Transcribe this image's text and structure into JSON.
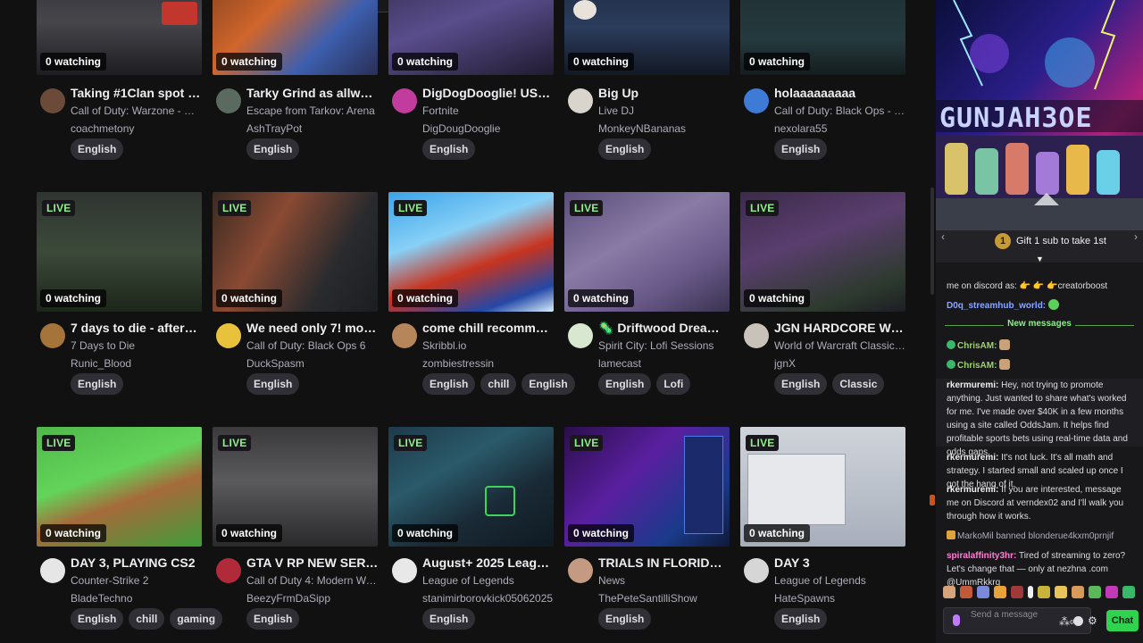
{
  "cards": [
    {
      "title": "Taking #1Clan spot in ...",
      "game": "Call of Duty: Warzone - Mob...",
      "streamer": "coachmetony",
      "viewers": "0 watching",
      "live": "",
      "tags": [
        "English"
      ]
    },
    {
      "title": "Tarky Grind as allways",
      "game": "Escape from Tarkov: Arena",
      "streamer": "AshTrayPot",
      "viewers": "0 watching",
      "live": "",
      "tags": [
        "English"
      ]
    },
    {
      "title": "DigDogDooglie! USE C...",
      "game": "Fortnite",
      "streamer": "DigDougDooglie",
      "viewers": "0 watching",
      "live": "",
      "tags": [
        "English"
      ]
    },
    {
      "title": "Big Up",
      "game": "Live DJ",
      "streamer": "MonkeyNBananas",
      "viewers": "0 watching",
      "live": "",
      "tags": [
        "English"
      ]
    },
    {
      "title": "holaaaaaaaaa",
      "game": "Call of Duty: Black Ops - De...",
      "streamer": "nexolara55",
      "viewers": "0 watching",
      "live": "",
      "tags": [
        "English"
      ]
    },
    {
      "title": "7 days to die - afterma...",
      "game": "7 Days to Die",
      "streamer": "Runic_Blood",
      "viewers": "0 watching",
      "live": "LIVE",
      "tags": [
        "English"
      ]
    },
    {
      "title": "We need only 7! more ...",
      "game": "Call of Duty: Black Ops 6",
      "streamer": "DuckSpasm",
      "viewers": "0 watching",
      "live": "LIVE",
      "tags": [
        "English"
      ]
    },
    {
      "title": "come chill recommend...",
      "game": "Skribbl.io",
      "streamer": "zombiestressin",
      "viewers": "0 watching",
      "live": "LIVE",
      "tags": [
        "English",
        "chill",
        "English"
      ]
    },
    {
      "title": "🦠 Driftwood Dreams 🌙",
      "game": "Spirit City: Lofi Sessions",
      "streamer": "lamecast",
      "viewers": "0 watching",
      "live": "LIVE",
      "tags": [
        "English",
        "Lofi"
      ]
    },
    {
      "title": "JGN HARDCORE WOW...",
      "game": "World of Warcraft Classic H...",
      "streamer": "jgnX",
      "viewers": "0 watching",
      "live": "LIVE",
      "tags": [
        "English",
        "Classic"
      ]
    },
    {
      "title": "DAY 3, PLAYING CS2",
      "game": "Counter-Strike 2",
      "streamer": "BladeTechno",
      "viewers": "0 watching",
      "live": "LIVE",
      "tags": [
        "English",
        "chill",
        "gaming"
      ]
    },
    {
      "title": "GTA V RP NEW SERVE...",
      "game": "Call of Duty 4: Modern Warf...",
      "streamer": "BeezyFrmDaSipp",
      "viewers": "0 watching",
      "live": "LIVE",
      "tags": [
        "English"
      ]
    },
    {
      "title": "August+ 2025 League ...",
      "game": "League of Legends",
      "streamer": "stanimirborovkick05062025",
      "viewers": "0 watching",
      "live": "LIVE",
      "tags": [
        "English"
      ]
    },
    {
      "title": "TRIALS IN FLORIDA? M...",
      "game": "News",
      "streamer": "ThePeteSantilliShow",
      "viewers": "0 watching",
      "live": "LIVE",
      "tags": [
        "English"
      ]
    },
    {
      "title": "DAY 3",
      "game": "League of Legends",
      "streamer": "HateSpawns",
      "viewers": "0 watching",
      "live": "LIVE",
      "tags": [
        "English"
      ]
    }
  ],
  "chat": {
    "banner_text": "GUNJAH3OE",
    "gift_count": "1",
    "gift_text": "Gift 1 sub to take 1st",
    "new_messages": "New messages",
    "messages": [
      {
        "user": "",
        "text": "me on discord as: 👉 👉 👉creatorboost"
      },
      {
        "user": "D0q_streamhub_world:",
        "text": ""
      },
      {
        "user": "ChrisAM:",
        "text": ""
      },
      {
        "user": "ChrisAM:",
        "text": ""
      },
      {
        "user": "rkermuremi:",
        "text": "Hey, not trying to promote anything. Just wanted to share what's worked for me. I've made over $40K in a few months using a site called OddsJam. It helps find profitable sports bets using real-time data and odds gaps."
      },
      {
        "user": "rkermuremi:",
        "text": "It's not luck. It's all math and strategy. I started small and scaled up once I got the hang of it."
      },
      {
        "user": "rkermuremi:",
        "text": "If you are interested, message me on Discord at verndex02 and I'll walk you through how it works."
      },
      {
        "user": "MarkoMil",
        "text": "banned blonderue4kxm0prnjif"
      },
      {
        "user": "spiralaffinity3hr:",
        "text": "Tired of streaming to zero? Let's change that — only at nezhna .com @UmmRkkrq"
      }
    ],
    "input_placeholder": "Send a message",
    "chat_button": "Chat"
  }
}
